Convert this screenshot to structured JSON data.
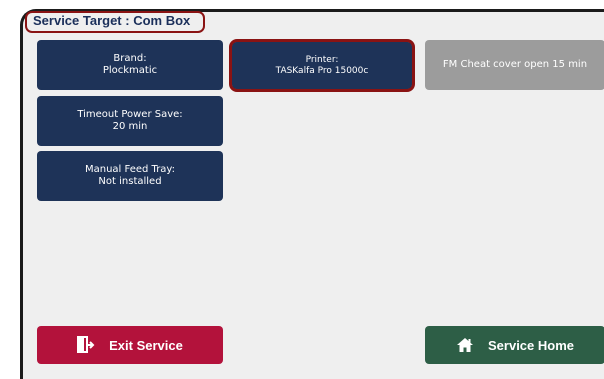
{
  "header": {
    "title": "Service Target : Com Box"
  },
  "tiles": [
    {
      "label": "Brand:",
      "value": "Plockmatic"
    },
    {
      "label": "Printer:",
      "value": "TASKalfa Pro 15000c"
    },
    {
      "label": "FM Cheat cover open 15 min",
      "value": ""
    },
    {
      "label": "Timeout Power Save:",
      "value": "20 min"
    },
    {
      "label": "Manual Feed Tray:",
      "value": "Not installed"
    }
  ],
  "footer": {
    "exit_label": "Exit Service",
    "home_label": "Service Home"
  },
  "colors": {
    "tile": "#1e3358",
    "tile_disabled": "#9c9c9c",
    "selection": "#8a1313",
    "exit": "#b3123b",
    "home": "#2d5e46"
  },
  "icons": {
    "exit": "exit-door-icon",
    "home": "home-icon"
  }
}
